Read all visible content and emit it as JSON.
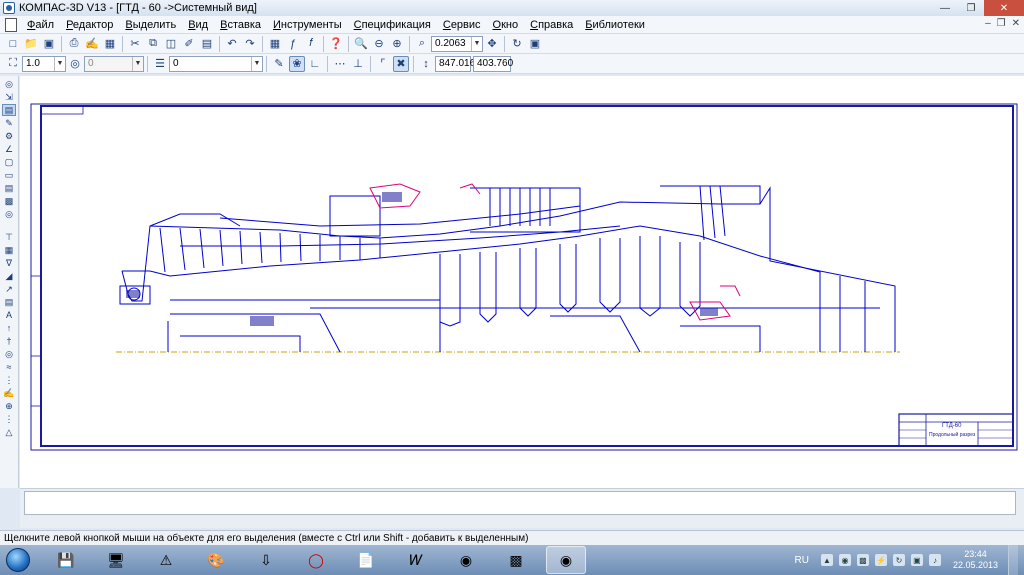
{
  "window": {
    "title": "КОМПАС-3D V13 - [ГТД - 60 ->Системный вид]",
    "controls": [
      "minimize",
      "restore",
      "close"
    ]
  },
  "menu": {
    "items": [
      "Файл",
      "Редактор",
      "Выделить",
      "Вид",
      "Вставка",
      "Инструменты",
      "Спецификация",
      "Сервис",
      "Окно",
      "Справка",
      "Библиотеки"
    ]
  },
  "toolbar1": {
    "zoom_value": "0.2063"
  },
  "toolbar2": {
    "line_scale": "1.0",
    "angle_value": "0",
    "layer_value": "0",
    "coord_x": "847.016",
    "coord_y": "403.760"
  },
  "drawing": {
    "stamp_line": "ГТД-60",
    "stamp_subtitle": "Продольный разрез"
  },
  "status": {
    "message": "Щелкните левой кнопкой мыши на объекте для его выделения (вместе с Ctrl или Shift - добавить к выделенным)"
  },
  "taskbar": {
    "lang": "RU",
    "time": "23:44",
    "date": "22.05.2013"
  },
  "colors": {
    "accent": "#2a5fa0",
    "drawing_lines": "#0000cc",
    "highlight": "#e0007a"
  }
}
